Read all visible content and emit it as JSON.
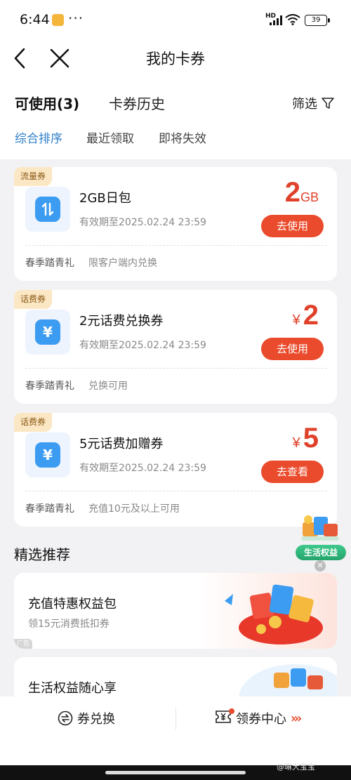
{
  "status_bar": {
    "time": "6:44",
    "more": "···",
    "network": "HD",
    "battery": "39"
  },
  "nav": {
    "title": "我的卡券"
  },
  "tabs": {
    "available": "可使用(3)",
    "history": "卡券历史",
    "filter": "筛选"
  },
  "sort": {
    "options": [
      "综合排序",
      "最近领取",
      "即将失效"
    ],
    "active": "综合排序"
  },
  "coupons": [
    {
      "tag": "流量券",
      "icon": "data-arrows-icon",
      "title": "2GB日包",
      "expiry": "有效期至2025.02.24 23:59",
      "value_prefix": "",
      "value_num": "2",
      "value_unit": "GB",
      "button": "去使用",
      "footer_a": "春季踏青礼",
      "footer_b": "限客户端内兑换"
    },
    {
      "tag": "话费券",
      "icon": "yuan-icon",
      "title": "2元话费兑换券",
      "expiry": "有效期至2025.02.24 23:59",
      "value_prefix": "¥",
      "value_num": "2",
      "value_unit": "",
      "button": "去使用",
      "footer_a": "春季踏青礼",
      "footer_b": "兑换可用"
    },
    {
      "tag": "话费券",
      "icon": "yuan-icon",
      "title": "5元话费加赠券",
      "expiry": "有效期至2025.02.24 23:59",
      "value_prefix": "¥",
      "value_num": "5",
      "value_unit": "",
      "button": "去查看",
      "footer_a": "春季踏青礼",
      "footer_b": "充值10元及以上可用"
    }
  ],
  "section": {
    "title": "精选推荐"
  },
  "float_badge": {
    "label": "生活权益"
  },
  "promos": [
    {
      "title": "充值特惠权益包",
      "subtitle": "领15元消费抵扣券",
      "ad": "广告"
    },
    {
      "title": "生活权益随心享"
    }
  ],
  "bottom_bar": {
    "left": "券兑换",
    "right": "领券中心",
    "arrows": "›››"
  },
  "watermark": "@琳大宝宝",
  "colors": {
    "accent_red": "#ea4b2c",
    "value_red": "#e0412a",
    "link_blue": "#2f7fc9",
    "icon_blue": "#3c9cf2",
    "tag_bg": "#fbe7c4"
  }
}
